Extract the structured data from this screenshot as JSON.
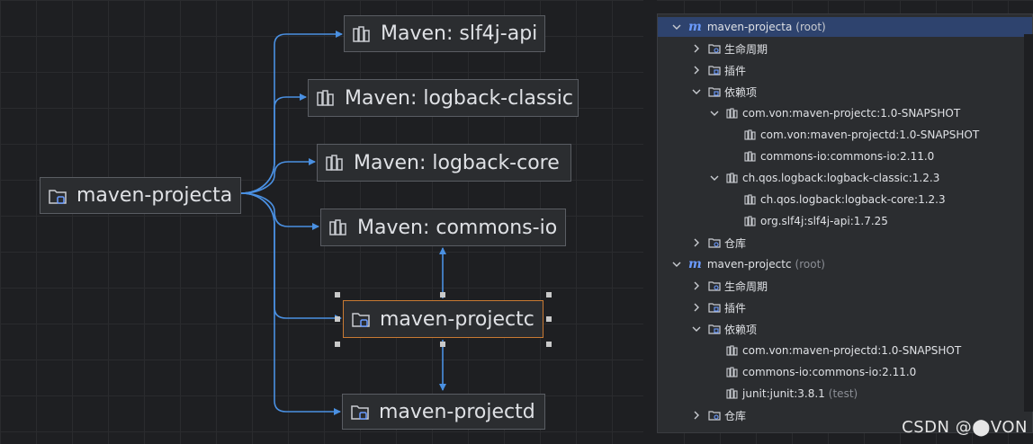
{
  "diagram": {
    "nodes": {
      "projecta": "maven-projecta",
      "slf4j": "Maven: slf4j-api",
      "logback_classic": "Maven: logback-classic",
      "logback_core": "Maven: logback-core",
      "commons_io": "Maven: commons-io",
      "projectc": "maven-projectc",
      "projectd": "maven-projectd"
    }
  },
  "tree": {
    "root_a": {
      "label": "maven-projecta",
      "suffix": "(root)"
    },
    "lifecycle": "生命周期",
    "plugins": "插件",
    "dependencies": "依赖项",
    "dep_projectc": "com.von:maven-projectc:1.0-SNAPSHOT",
    "dep_projectd": "com.von:maven-projectd:1.0-SNAPSHOT",
    "dep_commons": "commons-io:commons-io:2.11.0",
    "dep_logback_classic": "ch.qos.logback:logback-classic:1.2.3",
    "dep_logback_core": "ch.qos.logback:logback-core:1.2.3",
    "dep_slf4j": "org.slf4j:slf4j-api:1.7.25",
    "repository": "仓库",
    "root_c": {
      "label": "maven-projectc",
      "suffix": "(root)"
    },
    "c_dep_projectd": "com.von:maven-projectd:1.0-SNAPSHOT",
    "c_dep_commons": "commons-io:commons-io:2.11.0",
    "c_dep_junit": "junit:junit:3.8.1",
    "c_dep_junit_scope": "(test)",
    "m_logo": "m"
  },
  "watermark": "CSDN @⬤VON",
  "colors": {
    "edge": "#4a90e2",
    "selected_border": "#c97a33",
    "tree_selection": "#2e436e",
    "maven_logo": "#6b9bff"
  }
}
